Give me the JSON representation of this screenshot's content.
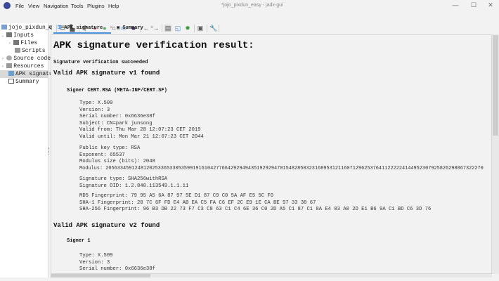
{
  "window": {
    "title": "*jojo_pixdun_easy - jadx-gui",
    "minimize": "—",
    "maximize": "☐",
    "close": "✕"
  },
  "menu": [
    "File",
    "View",
    "Navigation",
    "Tools",
    "Plugins",
    "Help"
  ],
  "toolbar_icons": [
    "open-icon",
    "add-files-icon",
    "sync-icon",
    "save-icon",
    "export-icon",
    "text-search-icon",
    "class-search-icon",
    "search-icon",
    "find-usage-icon",
    "find-icon",
    "home-icon",
    "window-icon",
    "logcat-icon",
    "back-icon",
    "forward-icon",
    "deobfuscate-icon",
    "quark-icon",
    "debug-icon",
    "stop-icon",
    "settings-icon"
  ],
  "tree": {
    "root": "jojo_pixdun_e",
    "items": [
      {
        "label": "Inputs"
      },
      {
        "label": "Files"
      },
      {
        "label": "Scripts"
      },
      {
        "label": "Source code"
      },
      {
        "label": "Resources"
      },
      {
        "label": "APK signatu"
      },
      {
        "label": "Summary"
      }
    ]
  },
  "tabs": [
    {
      "label": "APK signature",
      "close": "×"
    },
    {
      "label": "Summary",
      "close": "×"
    }
  ],
  "content": {
    "title": "APK signature verification result:",
    "status": "Signature verification succeeded",
    "v1": {
      "heading": "Valid APK signature v1 found",
      "signer": "Signer CERT.RSA (META-INF/CERT.SF)",
      "lines": [
        "Type: X.509",
        "Version: 3",
        "Serial number: 0x6636e38f",
        "Subject: CN=park junsong",
        "Valid from: Thu Mar 28 12:07:23 CET 2019",
        "Valid until: Mon Mar 21 12:07:23 CET 2044"
      ],
      "key": [
        "Public key type: RSA",
        "Exponent: 65537",
        "Modulus size (bits): 2048",
        "Modulus: 2056334591248120253365330535991916104277664292949435192929478154828503231689531211607129625376411222224144952307925826298867322270"
      ],
      "sig": [
        "Signature type: SHA256withRSA",
        "Signature OID: 1.2.840.113549.1.1.11"
      ],
      "fp": [
        "MD5 Fingerprint: 79 95 A5 6A 87 97 5E D1 87 C9 C0 5A AF E5 5C F0",
        "SHA-1 Fingerprint: 20 7C 6F FD E4 AB EA C5 FA C6 EF 2C E9 1E CA BE 97 33 38 67",
        "SHA-256 Fingerprint: 96 B3 DB 22 73 F7 C3 C8 63 C1 C4 6E 36 C0 2D A5 C1 87 C1 8A E4 03 A0 2D E1 B6 9A C1 BD C6 3D 76"
      ]
    },
    "v2": {
      "heading": "Valid APK signature v2 found",
      "signer": "Signer 1",
      "lines": [
        "Type: X.509",
        "Version: 3",
        "Serial number: 0x6636e38f"
      ]
    }
  },
  "colors": {
    "background": "#f2f2f2",
    "tab_active_underline": "#4a90d9",
    "selection": "#d9d9d9"
  }
}
